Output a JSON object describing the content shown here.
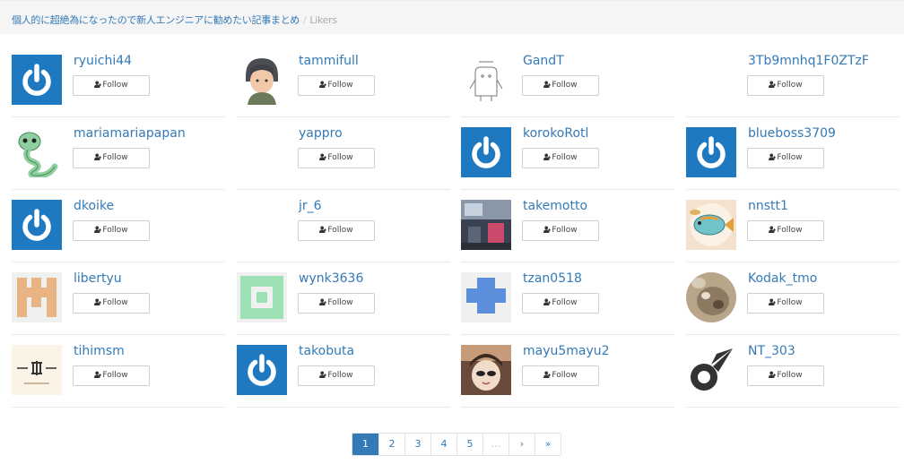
{
  "breadcrumb": {
    "parent": "個人的に超絶為になったので新人エンジニアに勧めたい記事まとめ",
    "separator": "/",
    "current": "Likers"
  },
  "follow_label": "Follow",
  "likers": [
    {
      "username": "ryuichi44",
      "avatar": "power-icon"
    },
    {
      "username": "tammifull",
      "avatar": "person-photo"
    },
    {
      "username": "GandT",
      "avatar": "sketch-drawing"
    },
    {
      "username": "3Tb9mnhq1F0ZTzF",
      "avatar": "blank"
    },
    {
      "username": "mariamariapapan",
      "avatar": "snake-drawing"
    },
    {
      "username": "yappro",
      "avatar": "blank"
    },
    {
      "username": "korokoRotl",
      "avatar": "power-icon"
    },
    {
      "username": "blueboss3709",
      "avatar": "power-icon"
    },
    {
      "username": "dkoike",
      "avatar": "power-icon"
    },
    {
      "username": "jr_6",
      "avatar": "blank"
    },
    {
      "username": "takemotto",
      "avatar": "room-photo"
    },
    {
      "username": "nnstt1",
      "avatar": "fish-drawing"
    },
    {
      "username": "libertyu",
      "avatar": "identicon-tan"
    },
    {
      "username": "wynk3636",
      "avatar": "identicon-green"
    },
    {
      "username": "tzan0518",
      "avatar": "identicon-blue"
    },
    {
      "username": "Kodak_tmo",
      "avatar": "animal-photo"
    },
    {
      "username": "tihimsm",
      "avatar": "logo-card"
    },
    {
      "username": "takobuta",
      "avatar": "power-icon"
    },
    {
      "username": "mayu5mayu2",
      "avatar": "face-photo"
    },
    {
      "username": "NT_303",
      "avatar": "comet-icon"
    }
  ],
  "pagination": {
    "pages": [
      "1",
      "2",
      "3",
      "4",
      "5"
    ],
    "current": "1",
    "ellipsis": "…",
    "next": "›",
    "last": "»"
  },
  "colors": {
    "link": "#337ab7",
    "power_icon_bg": "#1f79c1",
    "breadcrumb_bg": "#f5f5f5"
  }
}
